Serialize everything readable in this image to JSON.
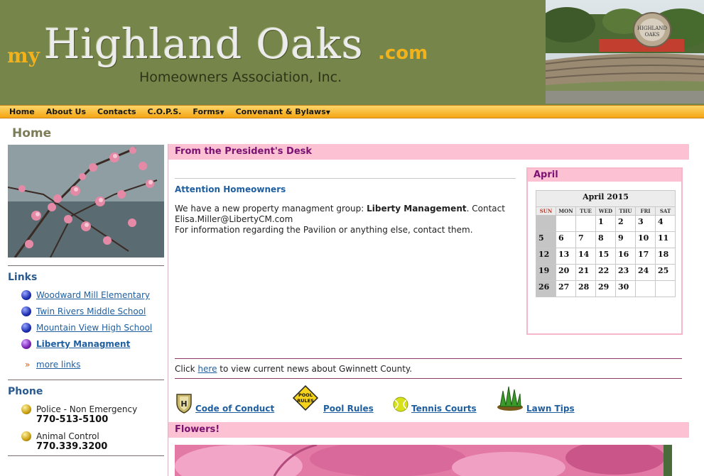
{
  "header": {
    "logo_prefix": "my",
    "logo_main": "Highland Oaks",
    "logo_suffix": ".com",
    "subtitle": "Homeowners Association, Inc.",
    "sign_text_1": "HIGHLAND",
    "sign_text_2": "OAKS"
  },
  "nav": {
    "items": [
      "Home",
      "About Us",
      "Contacts",
      "C.O.P.S.",
      "Forms",
      "Convenant & Bylaws"
    ]
  },
  "page_title": "Home",
  "sidebar": {
    "links_heading": "Links",
    "links": [
      "Woodward Mill Elementary",
      "Twin Rivers Middle School",
      "Mountain View High School",
      "Liberty Managment"
    ],
    "more_glyph": "»",
    "more_label": "more links",
    "phone_heading": "Phone",
    "phones": [
      {
        "name": "Police - Non Emergency",
        "number": "770-513-5100"
      },
      {
        "name": "Animal Control",
        "number": "770.339.3200"
      }
    ]
  },
  "main": {
    "section_title": "From the President's Desk",
    "attention": "Attention Homeowners",
    "para_pre": "We have a new property managment group: ",
    "para_bold": "Liberty Management",
    "para_post": ". Contact",
    "para_line2": "Elisa.Miller@LibertyCM.com",
    "para_line3": "For information regarding the Pavilion or anything else, contact them.",
    "news_pre": "Click ",
    "news_link": "here",
    "news_post": " to view current news about Gwinnett County.",
    "icon_links": [
      "Code of Conduct",
      "Pool Rules",
      "Tennis Courts",
      "Lawn Tips"
    ],
    "pool_sign_1": "POOL",
    "pool_sign_2": "RULES",
    "conduct_letter": "H",
    "flowers_title": "Flowers!"
  },
  "calendar": {
    "box_title": "April",
    "title": "April 2015",
    "day_headers": [
      "SUN",
      "MON",
      "TUE",
      "WED",
      "THU",
      "FRI",
      "SAT"
    ],
    "weeks": [
      [
        "",
        "",
        "",
        "1",
        "2",
        "3",
        "4"
      ],
      [
        "5",
        "6",
        "7",
        "8",
        "9",
        "10",
        "11"
      ],
      [
        "12",
        "13",
        "14",
        "15",
        "16",
        "17",
        "18"
      ],
      [
        "19",
        "20",
        "21",
        "22",
        "23",
        "24",
        "25"
      ],
      [
        "26",
        "27",
        "28",
        "29",
        "30",
        "",
        ""
      ]
    ]
  },
  "colors": {
    "header_bg": "#76854a",
    "nav_gold": "#f5a512",
    "pink_bar": "#fcc2d3",
    "bar_text": "#7b1172",
    "link_blue": "#1f5fa0"
  }
}
